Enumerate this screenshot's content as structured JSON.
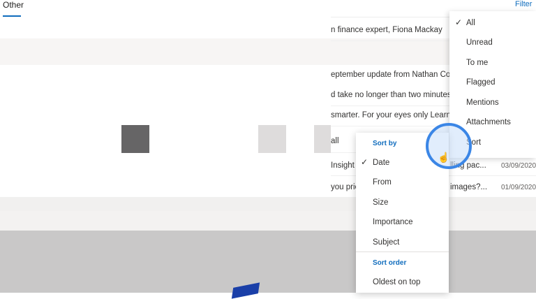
{
  "header": {
    "tab_label": "Other",
    "filter_label": "Filter"
  },
  "messages": [
    {
      "text": "n finance expert, Fiona Mackay",
      "date": ""
    },
    {
      "text": "",
      "date": ""
    },
    {
      "text": "eptember update from Nathan Coe, A",
      "date": ""
    },
    {
      "text": "d take no longer than two minutes to",
      "date": ""
    },
    {
      "text": "smarter. For your eyes only Learn m",
      "date": ""
    },
    {
      "text": "all",
      "date": ""
    },
    {
      "text": "Insight",
      "extra": "lling pac...",
      "date": "03/09/2020"
    },
    {
      "text": "you pric",
      "extra": "images?...",
      "date": "01/09/2020"
    }
  ],
  "filter_menu": {
    "items": [
      "All",
      "Unread",
      "To me",
      "Flagged",
      "Mentions",
      "Attachments",
      "Sort"
    ],
    "checked": "All"
  },
  "sort_menu": {
    "sort_by_heading": "Sort by",
    "sort_by_items": [
      "Date",
      "From",
      "Size",
      "Importance",
      "Subject"
    ],
    "checked": "Date",
    "sort_order_heading": "Sort order",
    "order_items": [
      "Oldest on top"
    ]
  },
  "icons": {
    "check": "✓",
    "pointer": "☝"
  },
  "colors": {
    "accent": "#0f6cbd",
    "ring": "#3b86e6"
  }
}
